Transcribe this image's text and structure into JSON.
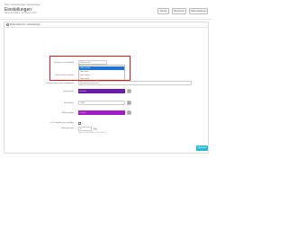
{
  "breadcrumb": "Shop  /  Modulmanager  /  Einstellungen",
  "page_title": "Einstellungen",
  "page_subtitle": "Modul aktualisiert 10 Oktober 2023",
  "top_buttons": [
    "Zurück",
    "Übersetzen",
    "Haken aktivieren"
  ],
  "panel_title": "Modul aktivieren · Einstellungen",
  "fields": {
    "position_label": "Position im Produktbild",
    "position_value": "Oben rechts",
    "options": [
      "Oben rechts",
      "Oben links",
      "Unten rechts",
      "Unten links"
    ],
    "badge_label": "Hinweis-Beschriftung",
    "badge_value": "Versandkostenfrei",
    "text_label": "Hinweis-Text in der Produktliste",
    "text_value": "Kostenloser Versand",
    "bg_label": "Hintergrund",
    "bg_value": "#6a1ca8",
    "fg_label": "Schriftfarbe",
    "fg_value": "#ffffff",
    "border_label": "Rahmenfarbe",
    "border_value": "#a21dc7",
    "enable_label": "Für Produktlisten verfügbar",
    "enable_checked": true,
    "days_label": "Anzeige-Tage",
    "days_value": "5",
    "days_unit": "Tag",
    "days_hint": "Zeigen Sie das Etikett so viele Tage an"
  },
  "save_label": "Speichern"
}
